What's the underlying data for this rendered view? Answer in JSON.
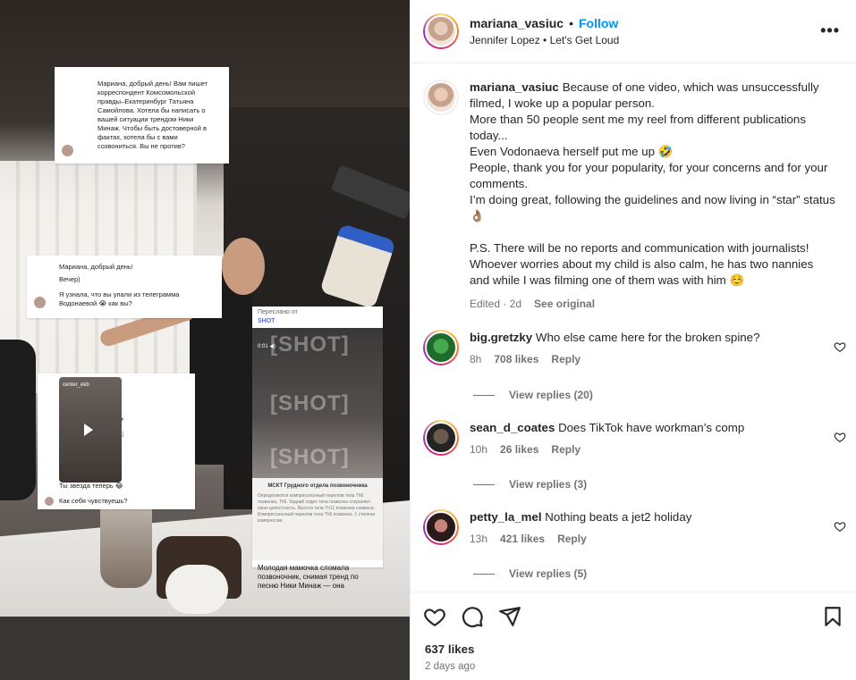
{
  "post": {
    "username": "mariana_vasiuc",
    "separator": "•",
    "follow_label": "Follow",
    "audio": "Jennifer Lopez • Let's Get Loud",
    "more_label": "•••"
  },
  "caption": {
    "username": "mariana_vasiuc",
    "text": "Because of one video, which was unsuccessfully filmed, I woke up a popular person.\nMore than 50 people sent me my reel from different publications today...\nEven Vodonaeva herself put me up 🤣\nPeople, thank you for your popularity, for your concerns and for your comments.\nI’m doing great, following the guidelines and now living in “star” status 👌🏽\n\nP.S. There will be no reports and communication with journalists! Whoever worries about my child is also calm, he has two nannies and while I was filming one of them was with him ☺️",
    "edited": "Edited · 2d",
    "see_original": "See original"
  },
  "comments": [
    {
      "username": "big.gretzky",
      "text": "Who else came here for the broken spine?",
      "time": "8h",
      "likes": "708 likes",
      "reply": "Reply",
      "view_replies": "View replies (20)",
      "avatar_color": "#2e8b3a"
    },
    {
      "username": "sean_d_coates",
      "text": "Does TikTok have workman’s comp",
      "time": "10h",
      "likes": "26 likes",
      "reply": "Reply",
      "view_replies": "View replies (3)",
      "avatar_color": "#3a3a3a"
    },
    {
      "username": "petty_la_mel",
      "text": "Nothing beats a jet2 holiday",
      "time": "13h",
      "likes": "421 likes",
      "reply": "Reply",
      "view_replies": "View replies (5)",
      "avatar_color": "#5a2e35"
    }
  ],
  "footer": {
    "likes": "637 likes",
    "ago": "2 days ago"
  },
  "media": {
    "card1_text": "Мариана, добрый день! Вам пишет корреспондент Комсомольской правды–Екатеринбург Татьяна Самойлова. Хотела бы написать о вашей ситуации трендом Ники Минаж. Чтобы быть достоверной в фактах, хотела бы с вами созвониться. Вы не против?",
    "card2_line1": "Мариана, добрый день!",
    "card2_line2": "Вечер)",
    "card2_line3": "Я узнала, что вы упали из телеграмма Водонаевой 😭 как вы?",
    "card3_head": "center_ekb",
    "card3_t1": "Ты звезда теперь 😂",
    "card3_t2": "Как себя чувствуешь?",
    "card4_forward": "Переслано от",
    "card4_source": "SHOT",
    "card4_time": "0:01 ◀)",
    "card4_watermark": "[SHOT]",
    "card4_doc_title": "МСКТ Грудного отдела позвоночника",
    "card4_doc_body": "Определяются компрессионный перелом тела Th6 позвонка, Th6. Задний отдел тела позвонка сохраняет свою целостность. Высота тела Th11 позвонка снижена. Компрессионный перелом тела Th6 позвонка. 1 степени компрессии.",
    "card4_caption": "Молодая мамочка сломала позвоночник, снимая тренд по песню Ники Минаж — она"
  }
}
